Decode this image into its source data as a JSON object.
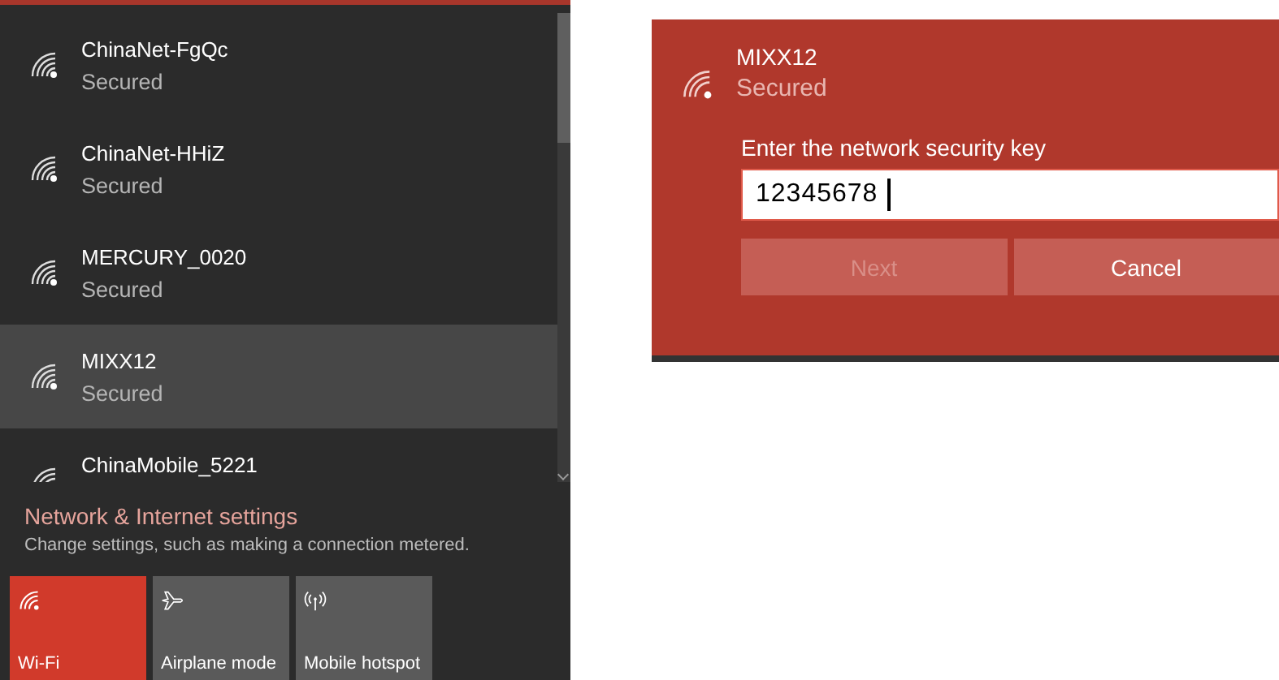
{
  "networks": [
    {
      "name": "ChinaNet-FgQc",
      "status": "Secured",
      "selected": false
    },
    {
      "name": "ChinaNet-HHiZ",
      "status": "Secured",
      "selected": false
    },
    {
      "name": "MERCURY_0020",
      "status": "Secured",
      "selected": false
    },
    {
      "name": "MIXX12",
      "status": "Secured",
      "selected": true
    },
    {
      "name": "ChinaMobile_5221",
      "selected": false
    }
  ],
  "settings_link": {
    "title": "Network & Internet settings",
    "description": "Change settings, such as making a connection metered."
  },
  "tiles": [
    {
      "kind": "wifi",
      "label": "Wi-Fi",
      "on": true
    },
    {
      "kind": "airplane",
      "label": "Airplane mode",
      "on": false
    },
    {
      "kind": "hotspot",
      "label": "Mobile hotspot",
      "on": false
    }
  ],
  "dialog": {
    "name": "MIXX12",
    "status": "Secured",
    "prompt": "Enter the network security key",
    "value": "12345678",
    "buttons": [
      {
        "label": "Next",
        "disabled": true
      },
      {
        "label": "Cancel",
        "disabled": false
      }
    ]
  }
}
